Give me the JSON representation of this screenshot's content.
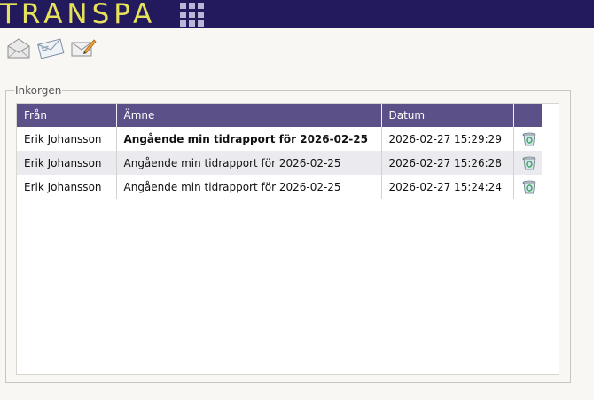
{
  "app": {
    "title": "TRANSPA"
  },
  "colors": {
    "header_bg": "#231a5e",
    "logo": "#e6e25a",
    "table_header": "#5b5088",
    "alt_row": "#ebeaee"
  },
  "header": {
    "apps_icon": "grid-icon"
  },
  "toolbar": {
    "buttons": [
      {
        "name": "inbox-button",
        "icon": "envelope-open-icon"
      },
      {
        "name": "sent-button",
        "icon": "envelopes-icon"
      },
      {
        "name": "compose-button",
        "icon": "envelope-pencil-icon"
      }
    ]
  },
  "inbox": {
    "legend": "Inkorgen",
    "columns": {
      "from": "Från",
      "subject": "Ämne",
      "date": "Datum"
    },
    "rows": [
      {
        "from": "Erik Johansson",
        "subject": "Angående min tidrapport för 2026-02-25",
        "date": "2026-02-27 15:29:29",
        "unread": true,
        "delete_icon": "trash-icon"
      },
      {
        "from": "Erik Johansson",
        "subject": "Angående min tidrapport för 2026-02-25",
        "date": "2026-02-27 15:26:28",
        "unread": false,
        "delete_icon": "trash-icon"
      },
      {
        "from": "Erik Johansson",
        "subject": "Angående min tidrapport för 2026-02-25",
        "date": "2026-02-27 15:24:24",
        "unread": false,
        "delete_icon": "trash-icon"
      }
    ]
  }
}
